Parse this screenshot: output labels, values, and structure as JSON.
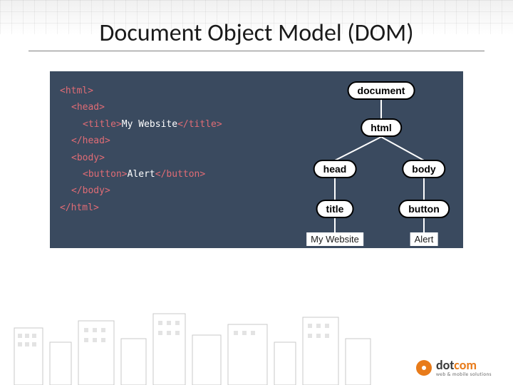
{
  "slide": {
    "title": "Document Object Model (DOM)"
  },
  "code": {
    "html_open": "<html>",
    "head_open": "<head>",
    "title_open": "<title>",
    "title_text": "My Website",
    "title_close": "</title>",
    "head_close": "</head>",
    "body_open": "<body>",
    "button_open": "<button>",
    "button_text": "Alert",
    "button_close": "</button>",
    "body_close": "</body>",
    "html_close": "</html>"
  },
  "tree": {
    "document": "document",
    "html": "html",
    "head": "head",
    "body": "body",
    "title": "title",
    "button": "button",
    "leaf_title": "My Website",
    "leaf_button": "Alert"
  },
  "logo": {
    "dot": "dot",
    "com": "com",
    "tagline": "web & mobile solutions"
  }
}
